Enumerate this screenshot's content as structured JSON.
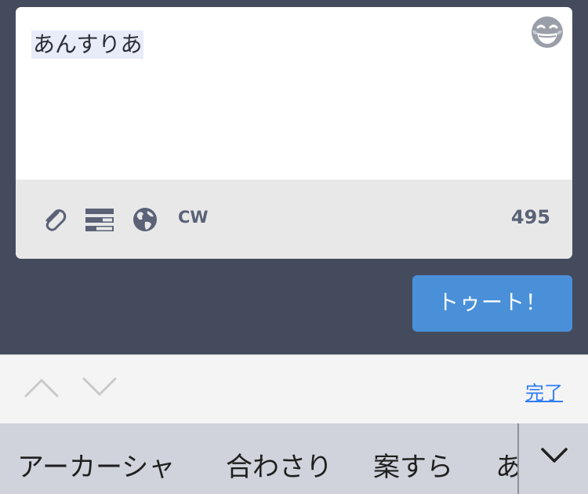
{
  "composer": {
    "text": "あんすりあ",
    "emoji_picker_icon": "grinning-squinting-face-icon",
    "toolbar": {
      "attach_icon": "paperclip-icon",
      "poll_icon": "poll-bars-icon",
      "visibility_icon": "globe-icon",
      "cw_label": "CW",
      "char_count": "495"
    }
  },
  "toot_button": {
    "label": "トゥート！"
  },
  "keyboard_accessory": {
    "prev_icon": "chevron-up-icon",
    "next_icon": "chevron-down-icon",
    "done_label": "完了"
  },
  "predictions": {
    "items": [
      "アーカーシャ",
      "合わさり",
      "案すら",
      "あ"
    ],
    "expand_icon": "chevron-down-icon"
  },
  "colors": {
    "background": "#444b5d",
    "toot_button": "#4a90d9",
    "icon": "#5b6277",
    "done_link": "#2f7cf6"
  }
}
